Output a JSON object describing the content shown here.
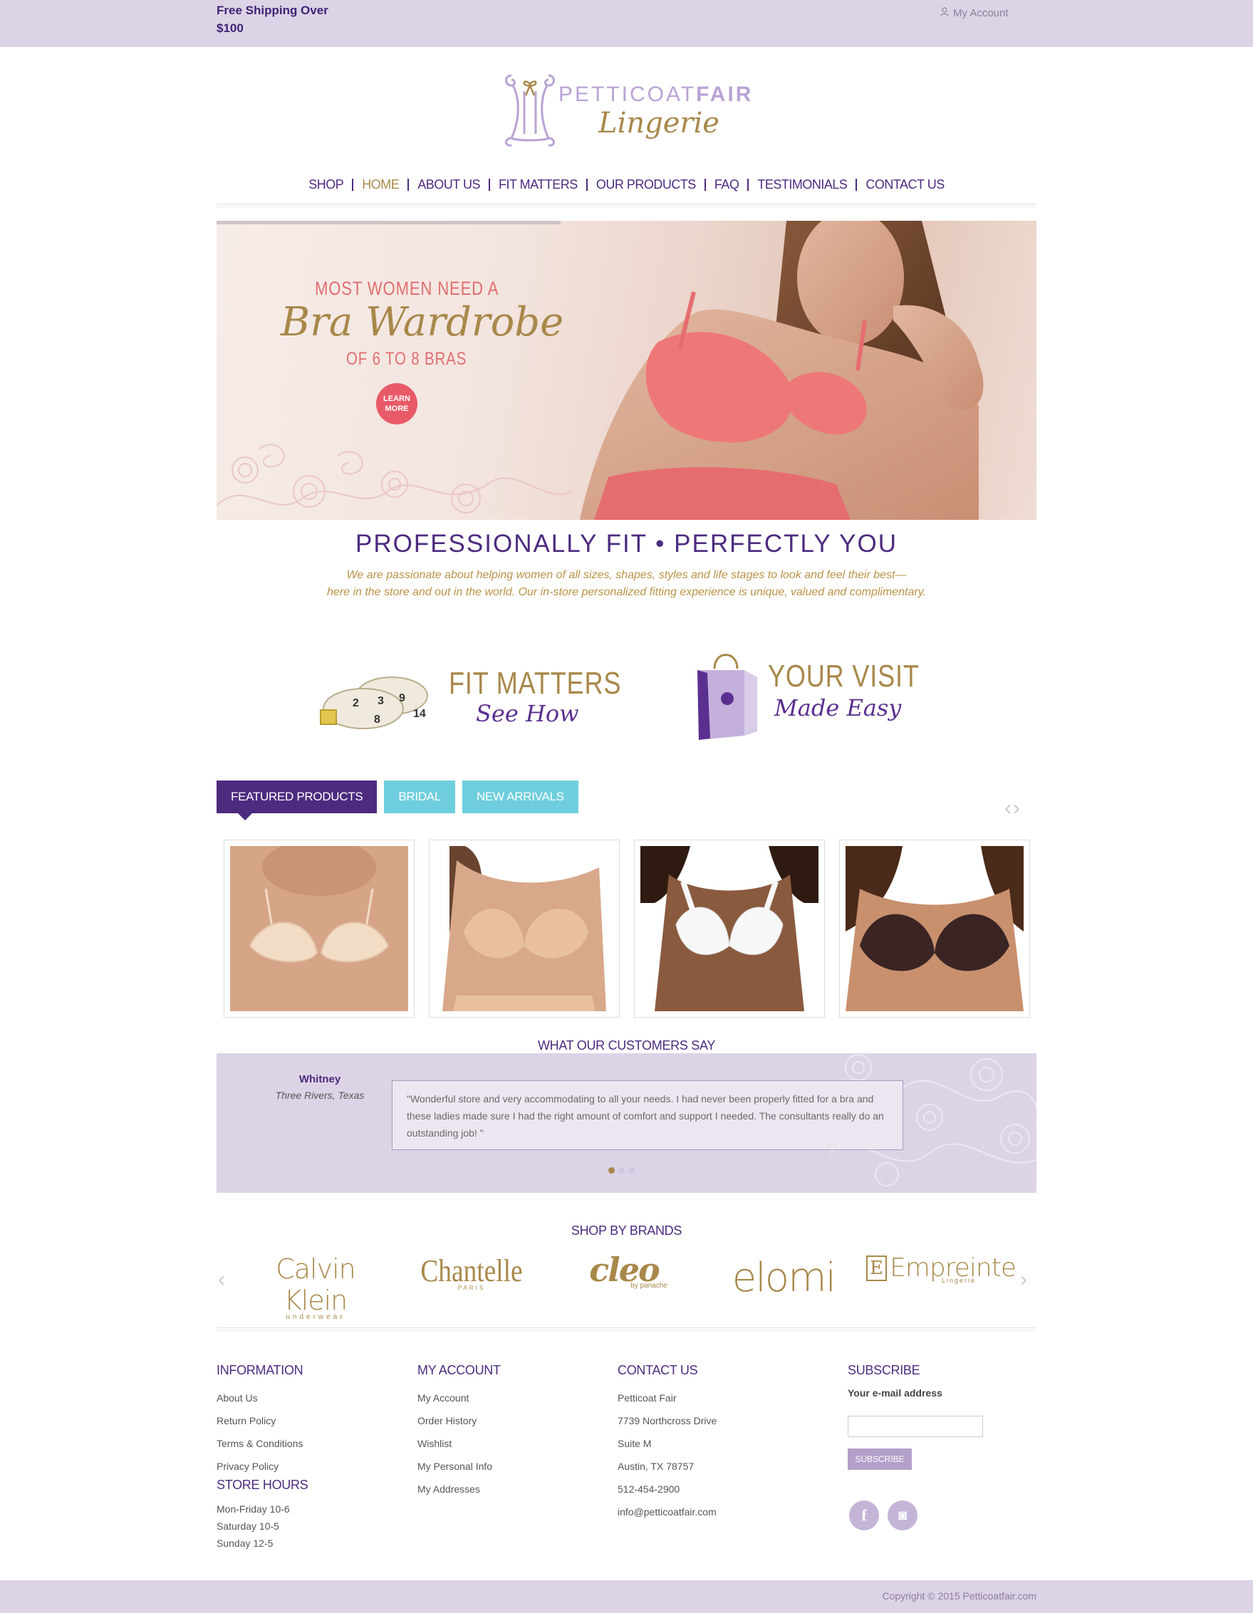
{
  "topbar": {
    "shipping": "Free Shipping Over $100",
    "account": "My Account"
  },
  "logo": {
    "name_part1": "PETTICOAT",
    "name_part2": "FAIR",
    "subtitle": "Lingerie"
  },
  "nav": {
    "items": [
      {
        "label": "SHOP",
        "active": false
      },
      {
        "label": "HOME",
        "active": true
      },
      {
        "label": "ABOUT US",
        "active": false
      },
      {
        "label": "FIT MATTERS",
        "active": false
      },
      {
        "label": "OUR PRODUCTS",
        "active": false
      },
      {
        "label": "FAQ",
        "active": false
      },
      {
        "label": "TESTIMONIALS",
        "active": false
      },
      {
        "label": "CONTACT US",
        "active": false
      }
    ]
  },
  "hero": {
    "line1": "MOST WOMEN NEED A",
    "line2": "Bra Wardrobe",
    "line3": "OF 6 TO 8 BRAS",
    "button": "LEARN MORE",
    "progress": 0.42
  },
  "tagline": {
    "title": "PROFESSIONALLY FIT • PERFECTLY YOU",
    "sub1": "We are passionate about helping women of all sizes, shapes, styles and life stages to look and feel their best—",
    "sub2": "here in the store and out in the world. Our in-store personalized fitting experience is unique, valued and complimentary."
  },
  "promos": {
    "fit": {
      "title": "FIT MATTERS",
      "sub": "See How"
    },
    "visit": {
      "title": "YOUR VISIT",
      "sub": "Made Easy"
    }
  },
  "tabs": [
    {
      "label": "FEATURED PRODUCTS",
      "active": true
    },
    {
      "label": "BRIDAL",
      "active": false
    },
    {
      "label": "NEW ARRIVALS",
      "active": false
    }
  ],
  "arrows": {
    "prev": "‹",
    "next": "›"
  },
  "testimonials": {
    "title": "WHAT OUR CUSTOMERS SAY",
    "name": "Whitney",
    "location": "Three Rivers, Texas",
    "quote": "\"Wonderful store and very accommodating to all your needs. I had never been properly fitted for a bra and these ladies made sure I had the right amount of comfort and support I needed. The consultants really do an outstanding job! \"",
    "active_dot": 0
  },
  "brands": {
    "title": "SHOP BY BRANDS",
    "items": [
      {
        "name": "Calvin Klein",
        "sub": "underwear"
      },
      {
        "name": "Chantelle",
        "sub": "PARIS"
      },
      {
        "name": "cleo",
        "sub": "by panache"
      },
      {
        "name": "elomi",
        "sub": ""
      },
      {
        "name": "Empreinte",
        "sub": "Lingerie"
      }
    ]
  },
  "footer": {
    "information": {
      "title": "INFORMATION",
      "links": [
        "About Us",
        "Return Policy",
        "Terms & Conditions",
        "Privacy Policy"
      ]
    },
    "hours": {
      "title": "STORE HOURS",
      "lines": [
        "Mon-Friday 10-6",
        "Saturday 10-5",
        "Sunday 12-5"
      ]
    },
    "account": {
      "title": "MY ACCOUNT",
      "links": [
        "My Account",
        "Order History",
        "Wishlist",
        "My Personal Info",
        "My Addresses"
      ]
    },
    "contact": {
      "title": "CONTACT US",
      "lines": [
        "Petticoat Fair",
        "7739 Northcross Drive",
        "Suite M",
        "Austin, TX 78757",
        "512-454-2900",
        "info@petticoatfair.com"
      ]
    },
    "subscribe": {
      "title": "SUBSCRIBE",
      "label": "Your e-mail address",
      "placeholder": "",
      "button": "SUBSCRIBE"
    },
    "social": {
      "facebook": "f",
      "instagram": "◙"
    },
    "copyright": "Copyright © 2015 Petticoatfair.com"
  },
  "colors": {
    "purple": "#4d2b7f",
    "gold": "#a8884a",
    "lavender": "#dcd3e6",
    "teal": "#6fcedd"
  }
}
